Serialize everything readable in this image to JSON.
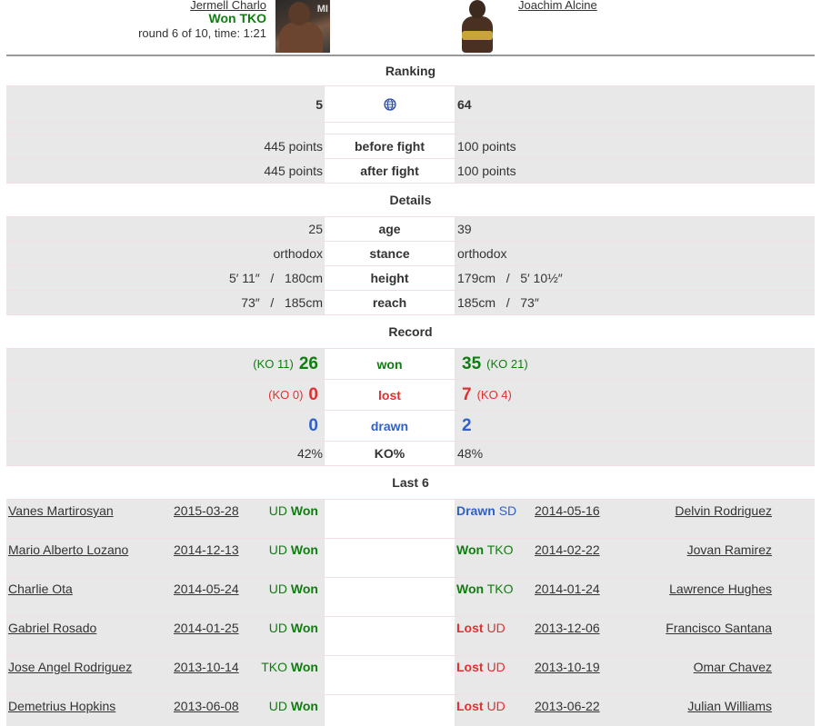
{
  "fighter1": {
    "name": "Jermell Charlo",
    "result": "Won TKO",
    "round_info": "round 6 of 10, time: 1:21",
    "photo_text": "MI",
    "ranking": "5",
    "points_before": "445 points",
    "points_after": "445 points",
    "age": "25",
    "stance": "orthodox",
    "height": "5′ 11″   /   180cm",
    "reach": "73″   /   185cm",
    "won": "26",
    "won_ko": "(KO 11)",
    "lost": "0",
    "lost_ko": "(KO 0)",
    "drawn": "0",
    "ko_pct": "42%"
  },
  "fighter2": {
    "name": "Joachim Alcine",
    "ranking": "64",
    "points_before": "100 points",
    "points_after": "100 points",
    "age": "39",
    "stance": "orthodox",
    "height": "179cm   /   5′ 10½″",
    "reach": "185cm   /   73″",
    "won": "35",
    "won_ko": "(KO 21)",
    "lost": "7",
    "lost_ko": "(KO 4)",
    "drawn": "2",
    "ko_pct": "48%"
  },
  "sections": {
    "ranking": "Ranking",
    "details": "Details",
    "record": "Record",
    "last": "Last 6"
  },
  "labels": {
    "before_fight": "before fight",
    "after_fight": "after fight",
    "age": "age",
    "stance": "stance",
    "height": "height",
    "reach": "reach",
    "won": "won",
    "lost": "lost",
    "drawn": "drawn",
    "ko_pct": "KO%"
  },
  "ranking_icon": "globe-icon",
  "last6": [
    {
      "l_opp": "Vanes Martirosyan",
      "l_date": "2015-03-28",
      "l_method": "UD",
      "l_outcome": "Won",
      "r_outcome": "Drawn",
      "r_method": "SD",
      "r_date": "2014-05-16",
      "r_opp": "Delvin Rodriguez"
    },
    {
      "l_opp": "Mario Alberto Lozano",
      "l_date": "2014-12-13",
      "l_method": "UD",
      "l_outcome": "Won",
      "r_outcome": "Won",
      "r_method": "TKO",
      "r_date": "2014-02-22",
      "r_opp": "Jovan Ramirez"
    },
    {
      "l_opp": "Charlie Ota",
      "l_date": "2014-05-24",
      "l_method": "UD",
      "l_outcome": "Won",
      "r_outcome": "Won",
      "r_method": "TKO",
      "r_date": "2014-01-24",
      "r_opp": "Lawrence Hughes"
    },
    {
      "l_opp": "Gabriel Rosado",
      "l_date": "2014-01-25",
      "l_method": "UD",
      "l_outcome": "Won",
      "r_outcome": "Lost",
      "r_method": "UD",
      "r_date": "2013-12-06",
      "r_opp": "Francisco Santana"
    },
    {
      "l_opp": "Jose Angel Rodriguez",
      "l_date": "2013-10-14",
      "l_method": "TKO",
      "l_outcome": "Won",
      "r_outcome": "Lost",
      "r_method": "UD",
      "r_date": "2013-10-19",
      "r_opp": "Omar Chavez"
    },
    {
      "l_opp": "Demetrius Hopkins",
      "l_date": "2013-06-08",
      "l_method": "UD",
      "l_outcome": "Won",
      "r_outcome": "Lost",
      "r_method": "UD",
      "r_date": "2013-06-22",
      "r_opp": "Julian Williams"
    }
  ],
  "colors": {
    "won": "#0f7d0f",
    "lost": "#e03030",
    "drawn": "#3060c8",
    "row_gray": "#e8e8e8"
  }
}
